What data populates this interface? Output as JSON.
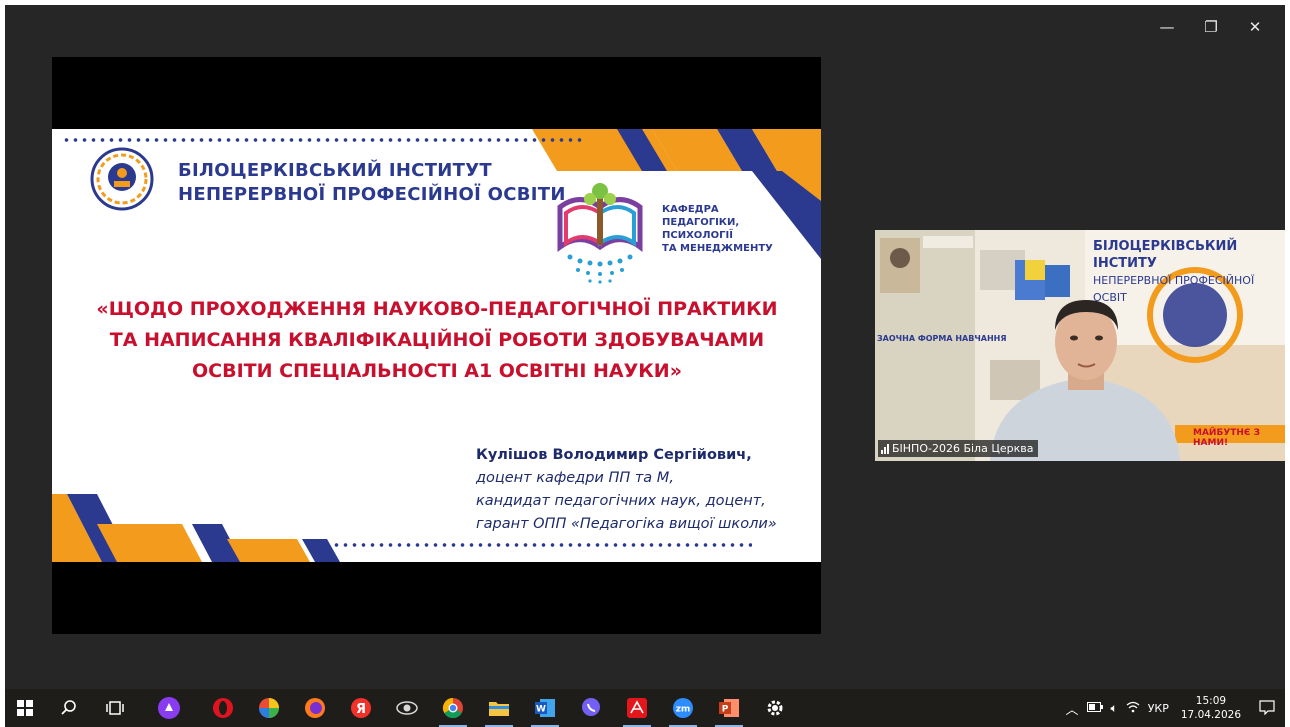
{
  "window": {
    "controls": {
      "minimize": "—",
      "restore": "❐",
      "close": "✕"
    }
  },
  "slide": {
    "institute_line1": "БІЛОЦЕРКІВСЬКИЙ ІНСТИТУТ",
    "institute_line2": "НЕПЕРЕРВНОЇ ПРОФЕСІЙНОЇ ОСВІТИ",
    "department_lines": [
      "КАФЕДРА",
      "ПЕДАГОГІКИ,",
      "ПСИХОЛОГІЇ",
      "ТА МЕНЕДЖМЕНТУ"
    ],
    "title_lines": [
      "«ЩОДО ПРОХОДЖЕННЯ НАУКОВО-ПЕДАГОГІЧНОЇ ПРАКТИКИ",
      "ТА НАПИСАННЯ КВАЛІФІКАЦІЙНОЇ РОБОТИ ЗДОБУВАЧАМИ",
      "ОСВІТИ СПЕЦІАЛЬНОСТІ А1 ОСВІТНІ НАУКИ»"
    ],
    "author_name": "Кулішов Володимир Сергійович,",
    "author_lines": [
      "доцент кафедри ПП та М,",
      "кандидат педагогічних наук, доцент,",
      "гарант ОПП «Педагогіка вищої школи»"
    ],
    "colors": {
      "navy": "#2b3a8f",
      "orange": "#f39b1c",
      "red": "#c8102e"
    }
  },
  "webcam": {
    "participant_label": "БІНПО-2026 Біла Церква",
    "banner_line1": "БІЛОЦЕРКІВСЬКИЙ ІНСТИТУ",
    "banner_line2": "НЕПЕРЕРВНОЇ ПРОФЕСІЙНОЇ ОСВІТ",
    "banner_slogan": "МАЙБУТНЄ З НАМИ!",
    "poster_heading": "ЗАОЧНА ФОРМА НАВЧАННЯ"
  },
  "taskbar": {
    "apps": [
      {
        "name": "start-button",
        "icon": "windows-icon"
      },
      {
        "name": "search-button",
        "icon": "search-icon"
      },
      {
        "name": "task-view-button",
        "icon": "task-view-icon"
      },
      {
        "name": "alice-app",
        "icon": "alice-icon"
      },
      {
        "name": "opera-app",
        "icon": "opera-icon"
      },
      {
        "name": "browser-app",
        "icon": "color-wheel-icon"
      },
      {
        "name": "firefox-app",
        "icon": "firefox-icon"
      },
      {
        "name": "yandex-app",
        "icon": "yandex-icon"
      },
      {
        "name": "eye-app",
        "icon": "eye-icon"
      },
      {
        "name": "chrome-app",
        "icon": "chrome-icon"
      },
      {
        "name": "file-explorer-app",
        "icon": "folder-icon"
      },
      {
        "name": "word-app",
        "icon": "word-icon"
      },
      {
        "name": "viber-app",
        "icon": "viber-icon"
      },
      {
        "name": "acrobat-app",
        "icon": "acrobat-icon"
      },
      {
        "name": "zoom-app",
        "icon": "zoom-icon"
      },
      {
        "name": "powerpoint-app",
        "icon": "powerpoint-icon"
      },
      {
        "name": "settings-app",
        "icon": "gear-icon"
      }
    ],
    "tray": {
      "chevron": "^",
      "language": "УКР",
      "time": "15:09",
      "date": "17.04.2026"
    }
  }
}
